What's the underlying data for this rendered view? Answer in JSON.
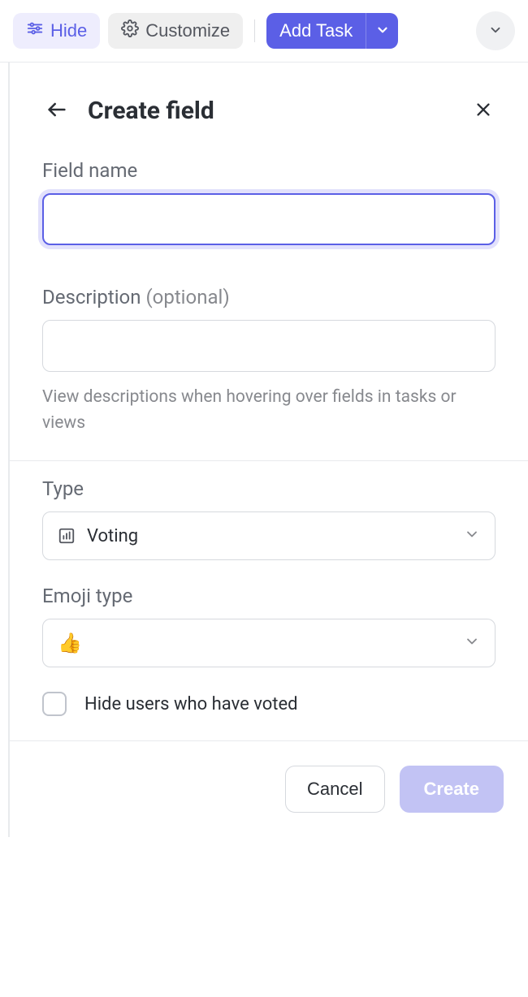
{
  "toolbar": {
    "hide_label": "Hide",
    "customize_label": "Customize",
    "add_task_label": "Add Task"
  },
  "panel": {
    "title": "Create field"
  },
  "form": {
    "field_name_label": "Field name",
    "field_name_value": "",
    "description_label": "Description",
    "description_optional": "(optional)",
    "description_value": "",
    "description_helper": "View descriptions when hovering over fields in tasks or views",
    "type_label": "Type",
    "type_value": "Voting",
    "emoji_type_label": "Emoji type",
    "emoji_value": "👍",
    "hide_users_label": "Hide users who have voted",
    "hide_users_checked": false
  },
  "footer": {
    "cancel_label": "Cancel",
    "create_label": "Create"
  }
}
